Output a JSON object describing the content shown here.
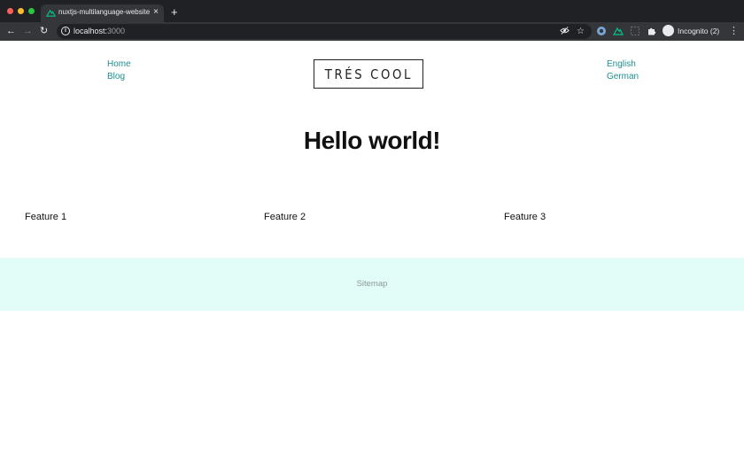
{
  "browser": {
    "tab_title": "nuxtjs-multilanguage-website",
    "url_host": "localhost:",
    "url_port": "3000",
    "profile_label": "Incognito (2)",
    "icons": [
      "back-icon",
      "forward-icon",
      "reload-icon",
      "info-icon",
      "eye-off-icon",
      "star-icon",
      "puzzle-icon",
      "menu-icon"
    ]
  },
  "header": {
    "nav_left": [
      "Home",
      "Blog"
    ],
    "logo": "TRÉS COOL",
    "nav_right": [
      "English",
      "German"
    ]
  },
  "hero": {
    "title": "Hello world!"
  },
  "features": [
    "Feature 1",
    "Feature 2",
    "Feature 3"
  ],
  "footer": {
    "link": "Sitemap"
  },
  "colors": {
    "link": "#1f8f8f",
    "footer_bg": "#e2fcf7",
    "chrome_dark": "#202124",
    "chrome_toolbar": "#35363a"
  }
}
